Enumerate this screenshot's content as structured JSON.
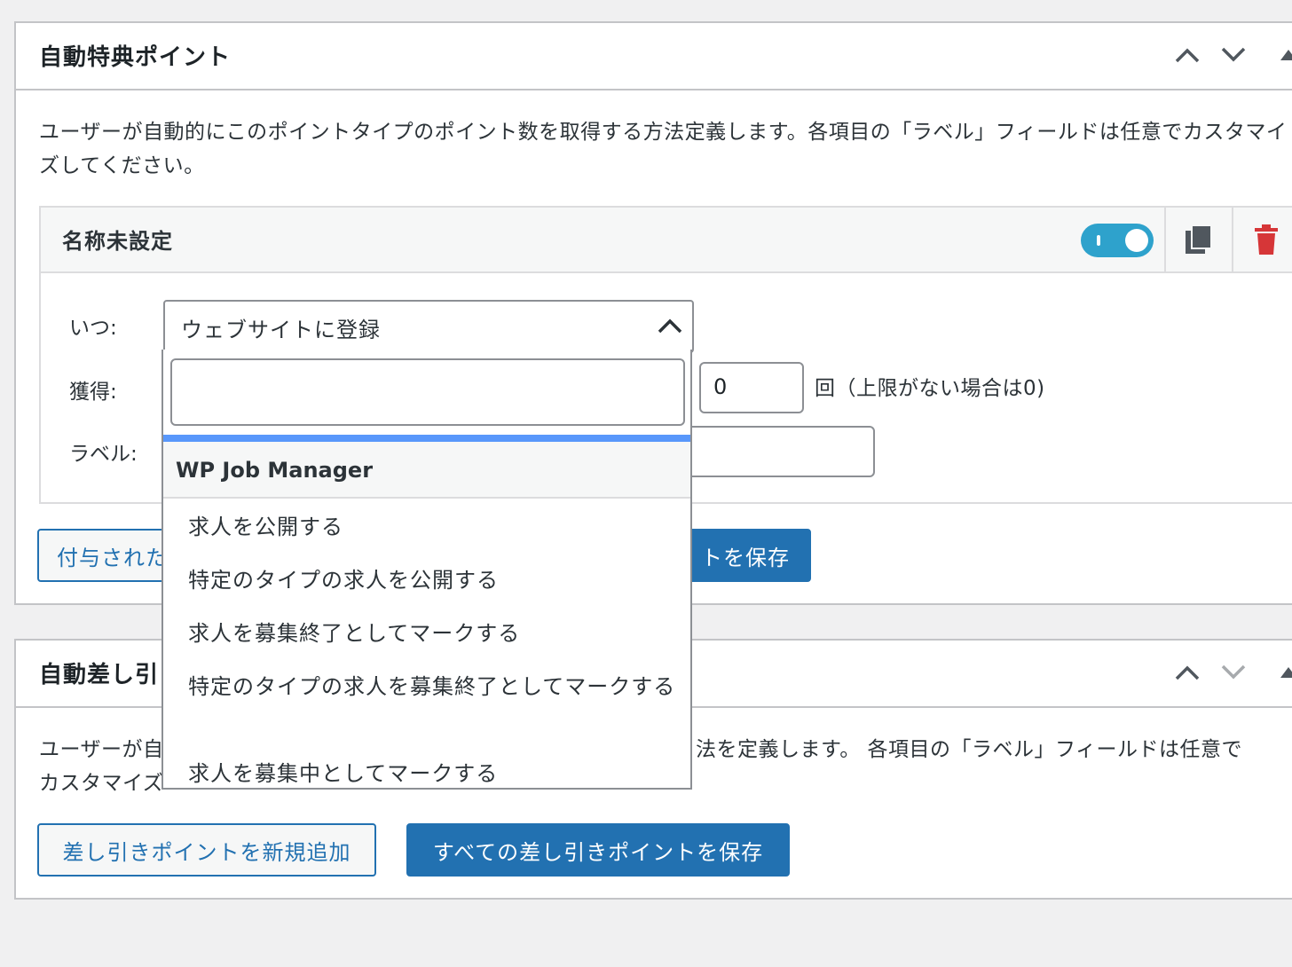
{
  "award_section": {
    "title": "自動特典ポイント",
    "description": "ユーザーが自動的にこのポイントタイプのポイント数を取得する方法定義します。各項目の「ラベル」フィールドは任意でカスタマイズしてください。",
    "hook": {
      "title": "名称未設定",
      "toggle_state": "on",
      "when_label": "いつ:",
      "when_value": "ウェブサイトに登録",
      "earn_label": "獲得:",
      "limit_value": "0",
      "limit_text": "回（上限がない場合は0)",
      "label_label": "ラベル:"
    },
    "add_button": "付与された",
    "save_button": "トを保存"
  },
  "dropdown": {
    "search_value": "",
    "group": "WP Job Manager",
    "options": [
      "求人を公開する",
      "特定のタイプの求人を公開する",
      "求人を募集終了としてマークする",
      "特定のタイプの求人を募集終了としてマークする",
      "求人を募集中としてマークする"
    ]
  },
  "deduct_section": {
    "title": "自動差し引",
    "description_left": "ユーザーが自",
    "description_right": "法を定義します。 各項目の「ラベル」フィールドは任意で",
    "description_line2": "カスタマイズ",
    "add_button": "差し引きポイントを新規追加",
    "save_button": "すべての差し引きポイントを保存"
  },
  "colors": {
    "primary": "#2271b1",
    "toggle": "#2ea2cc",
    "trash": "#d63638",
    "highlight": "#5897fb"
  }
}
